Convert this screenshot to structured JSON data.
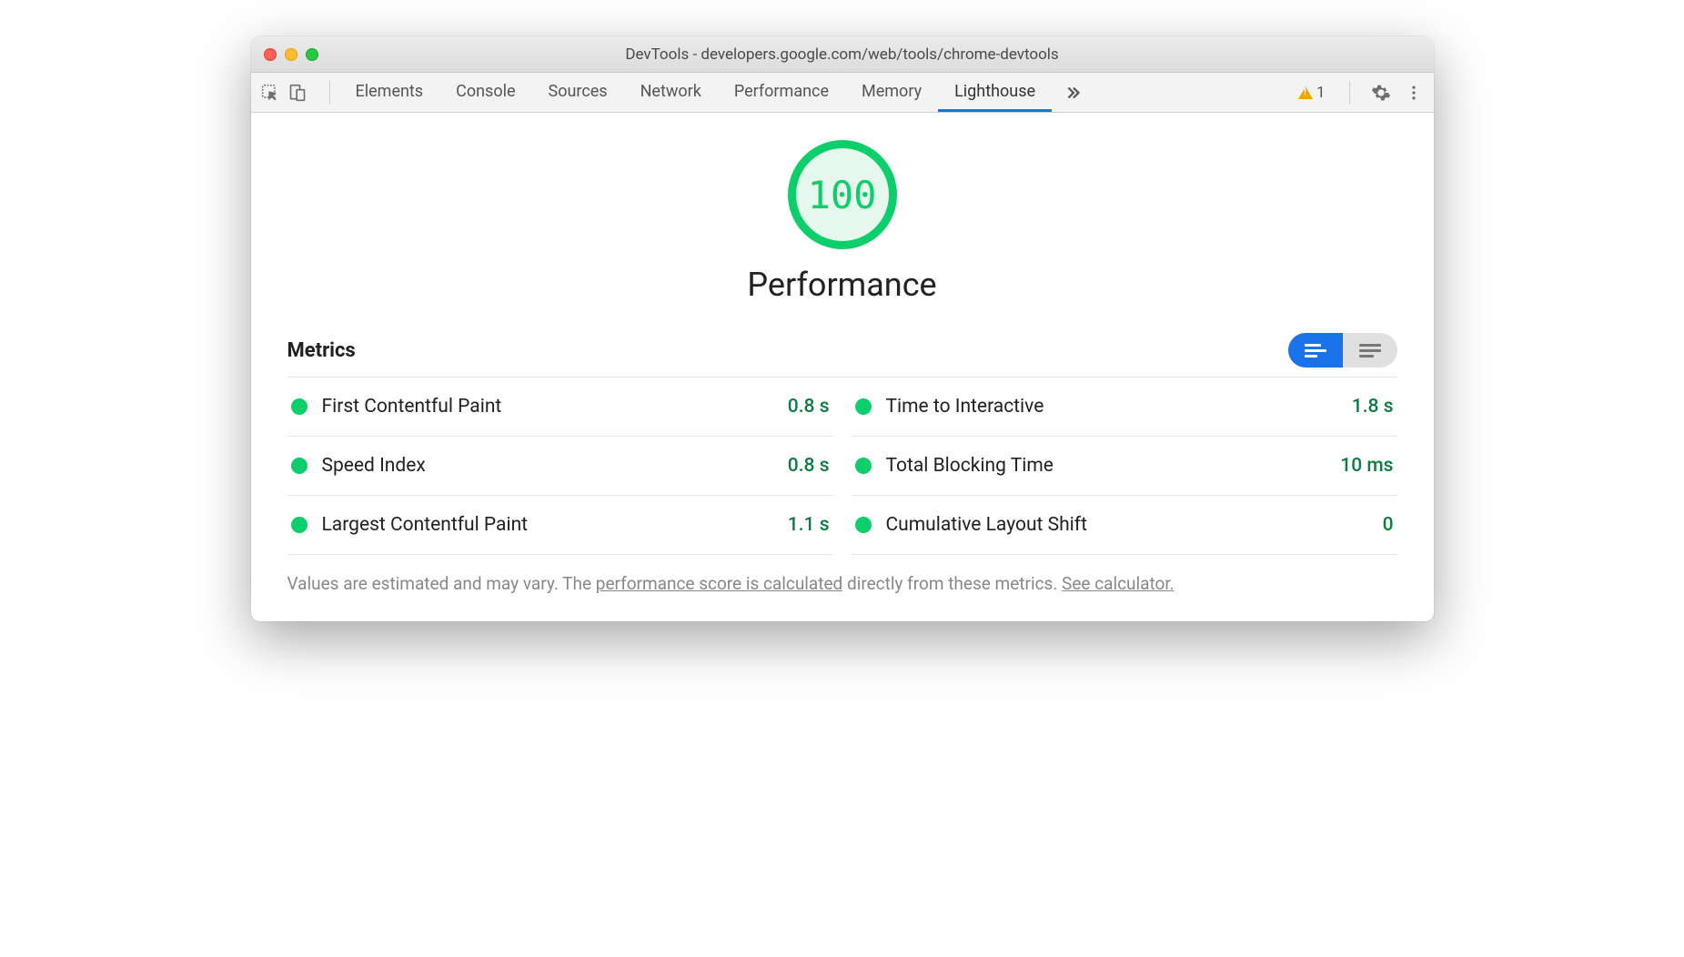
{
  "window": {
    "title": "DevTools - developers.google.com/web/tools/chrome-devtools"
  },
  "tabs": {
    "items": [
      "Elements",
      "Console",
      "Sources",
      "Network",
      "Performance",
      "Memory",
      "Lighthouse"
    ],
    "active": "Lighthouse"
  },
  "warnings": {
    "count": "1"
  },
  "lighthouse": {
    "score": "100",
    "category": "Performance",
    "metrics_label": "Metrics",
    "metrics": [
      {
        "name": "First Contentful Paint",
        "value": "0.8 s"
      },
      {
        "name": "Time to Interactive",
        "value": "1.8 s"
      },
      {
        "name": "Speed Index",
        "value": "0.8 s"
      },
      {
        "name": "Total Blocking Time",
        "value": "10 ms"
      },
      {
        "name": "Largest Contentful Paint",
        "value": "1.1 s"
      },
      {
        "name": "Cumulative Layout Shift",
        "value": "0"
      }
    ],
    "footnote": {
      "pre": "Values are estimated and may vary. The ",
      "link1": "performance score is calculated",
      "mid": " directly from these metrics. ",
      "link2": "See calculator."
    }
  }
}
